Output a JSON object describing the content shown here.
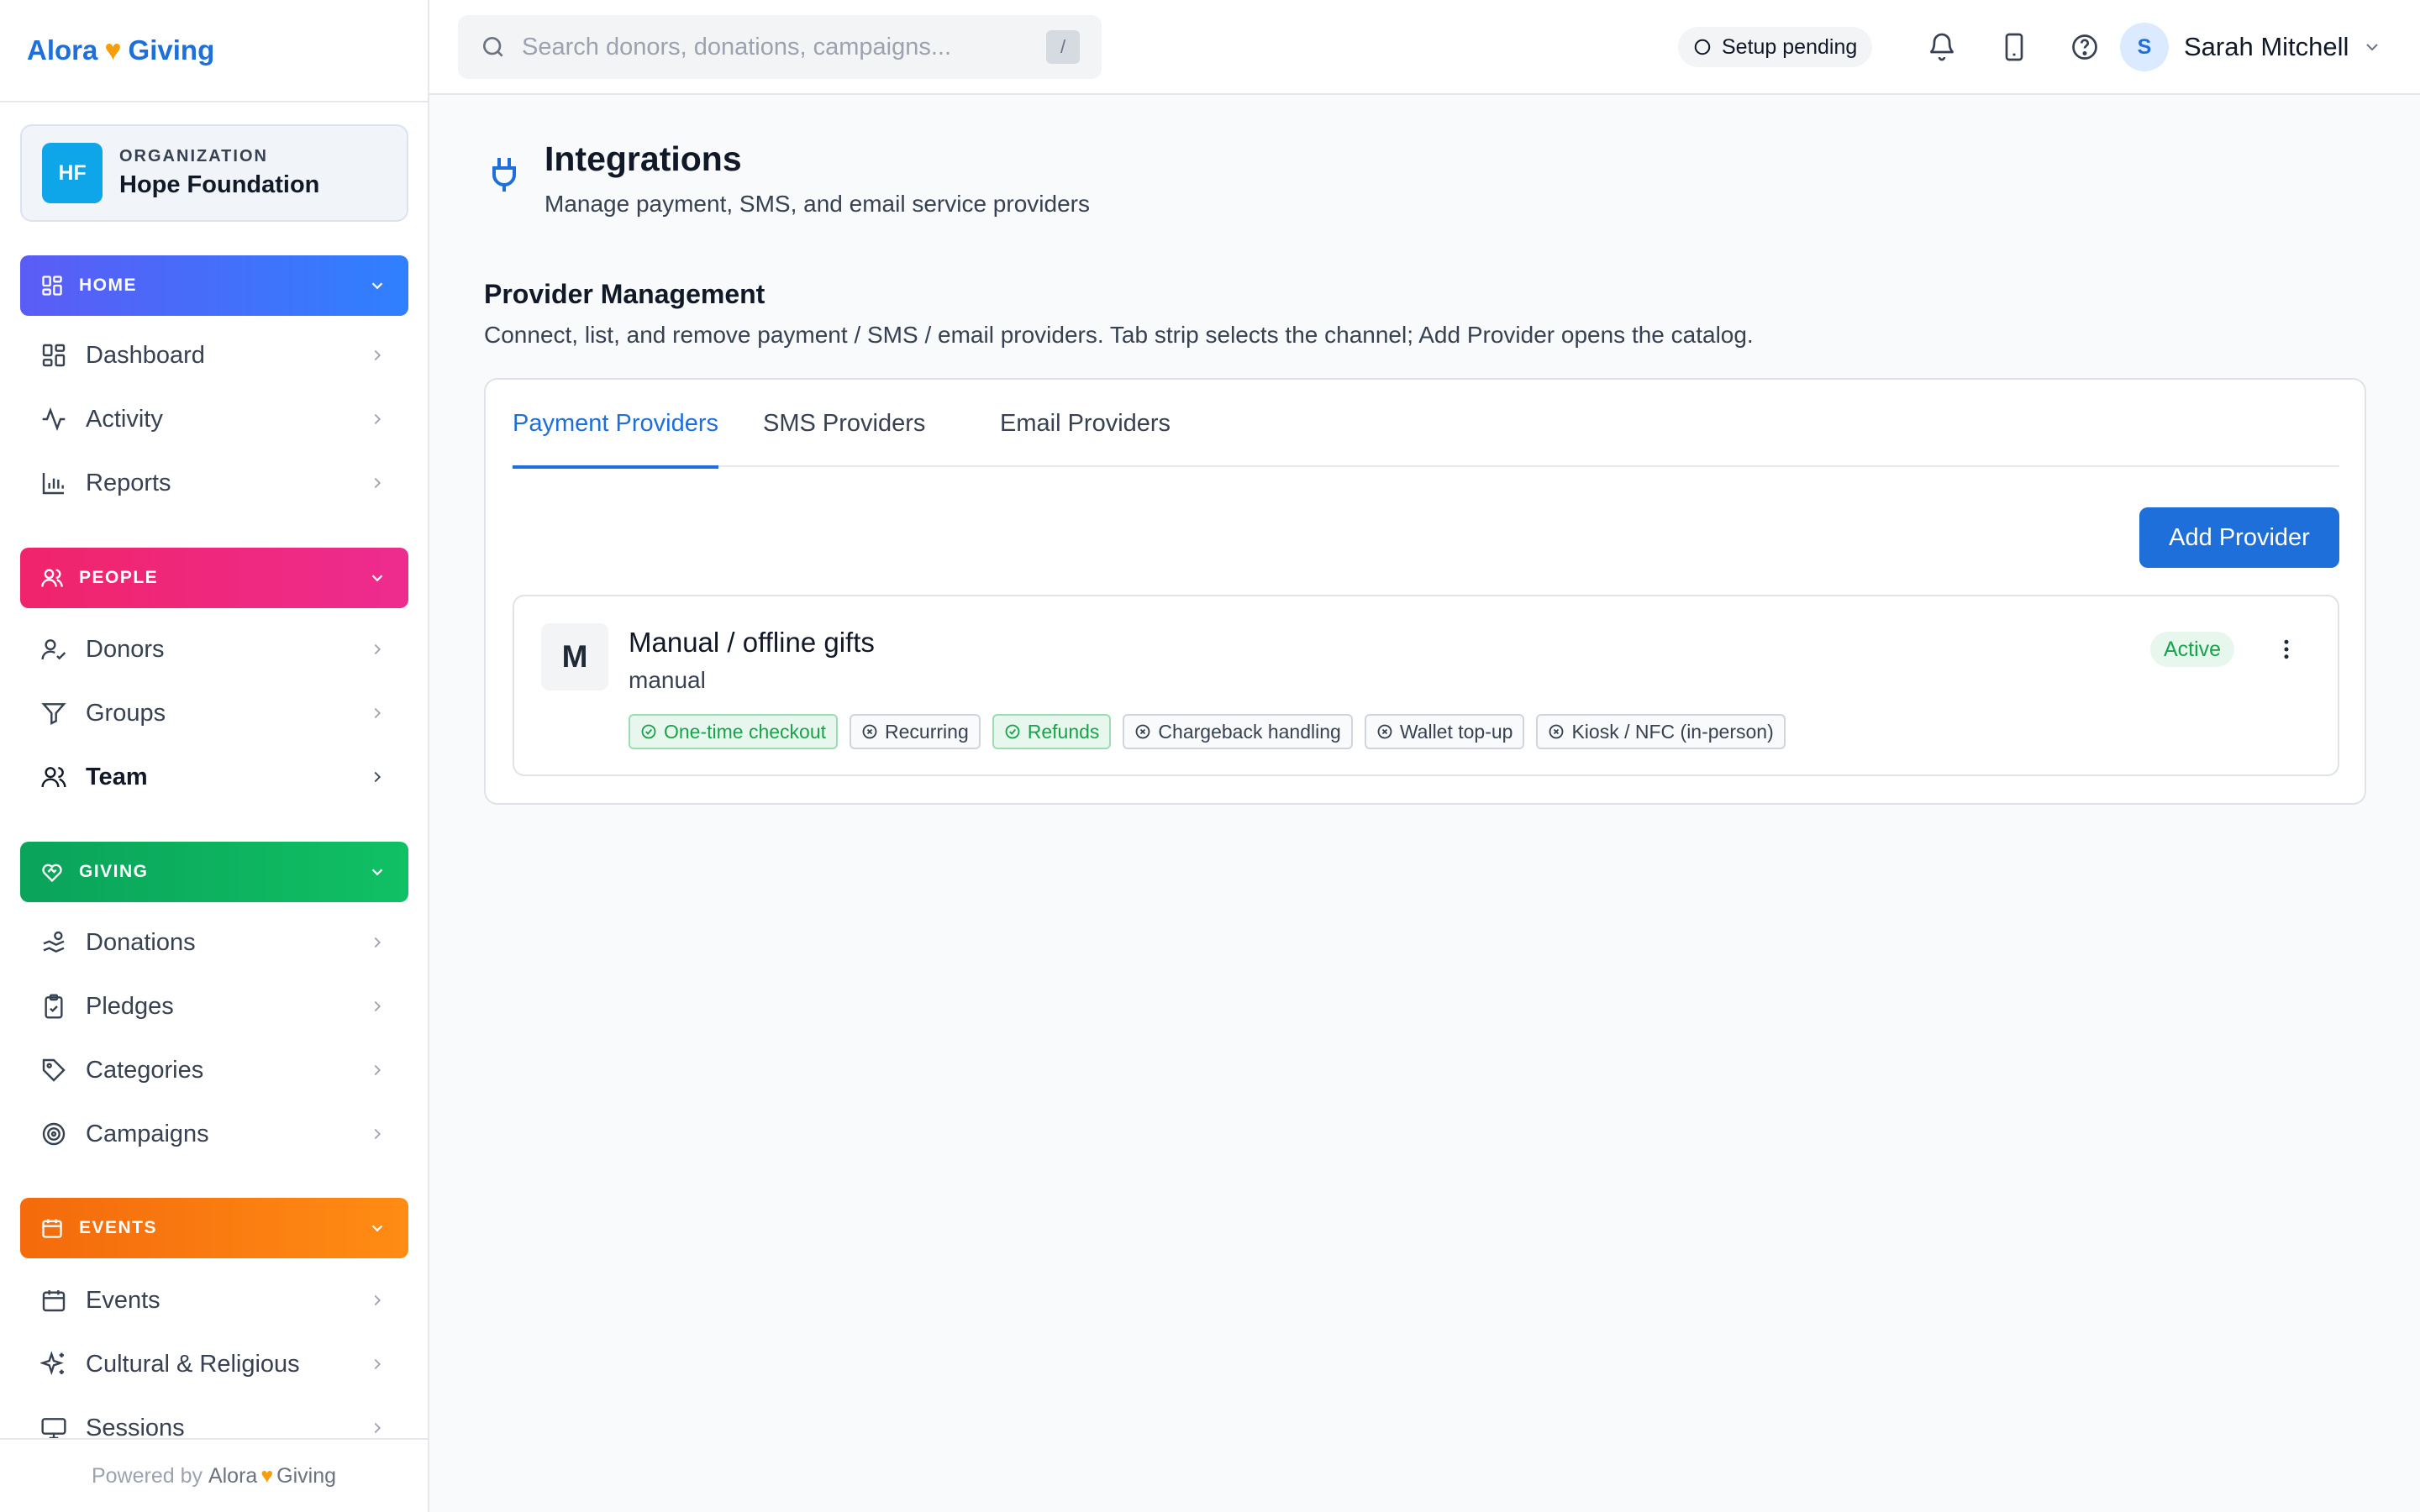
{
  "brand": {
    "word1": "Alora",
    "word2": "Giving"
  },
  "organization": {
    "caption": "ORGANIZATION",
    "initials": "HF",
    "name": "Hope Foundation"
  },
  "sidebar": {
    "sections": {
      "home": {
        "label": "HOME",
        "color": "#3b6cf7"
      },
      "people": {
        "label": "PEOPLE",
        "color": "#ef2a7a"
      },
      "giving": {
        "label": "GIVING",
        "color": "#0db25f"
      },
      "events": {
        "label": "EVENTS",
        "color": "#f77a10"
      }
    },
    "items": {
      "dashboard": "Dashboard",
      "activity": "Activity",
      "reports": "Reports",
      "donors": "Donors",
      "groups": "Groups",
      "team": "Team",
      "donations": "Donations",
      "pledges": "Pledges",
      "categories": "Categories",
      "campaigns": "Campaigns",
      "events": "Events",
      "cultural": "Cultural & Religious",
      "sessions": "Sessions"
    },
    "footer": {
      "prefix": "Powered by",
      "word1": "Alora",
      "word2": "Giving"
    }
  },
  "topbar": {
    "search_placeholder": "Search donors, donations, campaigns...",
    "search_shortcut": "/",
    "setup_status": "Setup pending",
    "user_initial": "S",
    "user_name": "Sarah Mitchell"
  },
  "page": {
    "title": "Integrations",
    "subtitle": "Manage payment, SMS, and email service providers",
    "section_title": "Provider Management",
    "section_description": "Connect, list, and remove payment / SMS / email providers. Tab strip selects the channel; Add Provider opens the catalog."
  },
  "tabs": [
    "Payment Providers",
    "SMS Providers",
    "Email Providers"
  ],
  "add_provider_label": "Add Provider",
  "provider": {
    "initial": "M",
    "name": "Manual / offline gifts",
    "type": "manual",
    "status": "Active",
    "capabilities": [
      {
        "label": "One-time checkout",
        "enabled": true
      },
      {
        "label": "Recurring",
        "enabled": false
      },
      {
        "label": "Refunds",
        "enabled": true
      },
      {
        "label": "Chargeback handling",
        "enabled": false
      },
      {
        "label": "Wallet top-up",
        "enabled": false
      },
      {
        "label": "Kiosk / NFC (in-person)",
        "enabled": false
      }
    ]
  },
  "colors": {
    "accent": "#1e6fd9",
    "success": "#16a34a",
    "brand_heart": "#f59e0b"
  }
}
